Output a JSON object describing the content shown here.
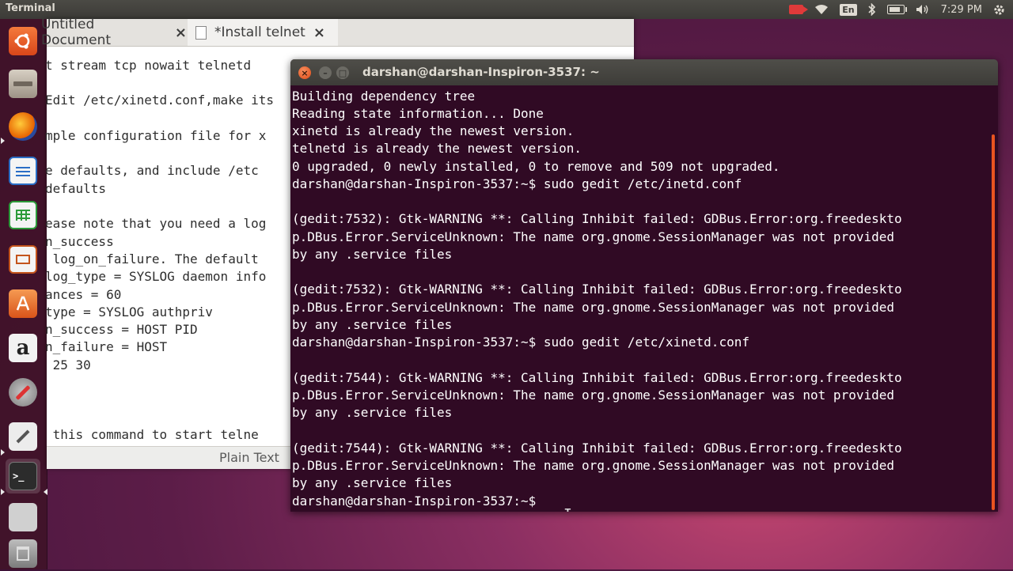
{
  "top_panel": {
    "app_title": "Terminal",
    "lang_label": "En",
    "clock": "7:29 PM",
    "indicators": [
      "camera-icon",
      "wifi-icon",
      "keyboard-lang",
      "bluetooth-icon",
      "battery-icon",
      "volume-icon",
      "clock",
      "gear-icon"
    ]
  },
  "launcher": {
    "items": [
      "ubuntu-dash",
      "files",
      "firefox",
      "libreoffice-writer",
      "libreoffice-calc",
      "libreoffice-impress",
      "software-center",
      "amazon",
      "system-settings",
      "text-editor",
      "terminal",
      "workspace-switcher",
      "trash"
    ]
  },
  "gedit": {
    "tabs": [
      {
        "label": "Untitled Document"
      },
      {
        "label": "*Install telnet"
      }
    ],
    "tab_close": "×",
    "lines": [
      "t stream tcp nowait telnetd",
      "",
      "Edit /etc/xinetd.conf,make its",
      "",
      "mple configuration file for x",
      "",
      "e defaults, and include /etc",
      "defaults",
      "",
      "ease note that you need a log",
      "n_success",
      " log_on_failure. The default",
      "log_type = SYSLOG daemon info",
      "ances = 60",
      "type = SYSLOG authpriv",
      "n_success = HOST PID",
      "n_failure = HOST",
      " 25 30",
      "",
      "",
      "",
      "",
      " this command to start telne"
    ],
    "status_text": "Plain Text"
  },
  "terminal": {
    "title": "darshan@darshan-Inspiron-3537: ~",
    "close_glyph": "×",
    "min_glyph": "–",
    "max_glyph": "□",
    "lines": [
      "Building dependency tree",
      "Reading state information... Done",
      "xinetd is already the newest version.",
      "telnetd is already the newest version.",
      "0 upgraded, 0 newly installed, 0 to remove and 509 not upgraded.",
      "darshan@darshan-Inspiron-3537:~$ sudo gedit /etc/inetd.conf",
      "",
      "(gedit:7532): Gtk-WARNING **: Calling Inhibit failed: GDBus.Error:org.freedeskto",
      "p.DBus.Error.ServiceUnknown: The name org.gnome.SessionManager was not provided",
      "by any .service files",
      "",
      "(gedit:7532): Gtk-WARNING **: Calling Inhibit failed: GDBus.Error:org.freedeskto",
      "p.DBus.Error.ServiceUnknown: The name org.gnome.SessionManager was not provided",
      "by any .service files",
      "darshan@darshan-Inspiron-3537:~$ sudo gedit /etc/xinetd.conf",
      "",
      "(gedit:7544): Gtk-WARNING **: Calling Inhibit failed: GDBus.Error:org.freedeskto",
      "p.DBus.Error.ServiceUnknown: The name org.gnome.SessionManager was not provided",
      "by any .service files",
      "",
      "(gedit:7544): Gtk-WARNING **: Calling Inhibit failed: GDBus.Error:org.freedeskto",
      "p.DBus.Error.ServiceUnknown: The name org.gnome.SessionManager was not provided",
      "by any .service files",
      "darshan@darshan-Inspiron-3537:~$ "
    ]
  },
  "colors": {
    "terminal_bg": "#300a24",
    "ubuntu_orange": "#e95420",
    "panel_bg": "#3c3b37"
  }
}
